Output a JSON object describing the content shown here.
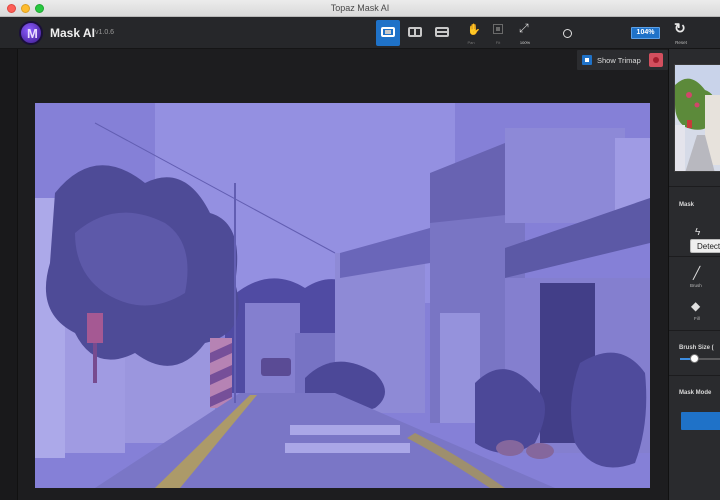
{
  "window": {
    "title": "Topaz Mask AI"
  },
  "app": {
    "name": "Mask AI",
    "version": "v1.0.6"
  },
  "toolbar": {
    "view_buttons": [
      {
        "name": "single-view-button",
        "active": true
      },
      {
        "name": "side-by-side-view-button",
        "active": false
      },
      {
        "name": "split-view-button",
        "active": false
      }
    ],
    "pan_label": "Pan",
    "fit_label": "Fit",
    "zoom_100_label": "100%",
    "zoom_value": "104%",
    "reset_label": "Reset"
  },
  "canvas": {
    "show_trimap_label": "Show Trimap",
    "show_trimap_checked": true,
    "trimap_color": "#d34f5e",
    "overlay_color": "#5a55d8"
  },
  "panel": {
    "mask_title": "Mask",
    "detect_label": "Detect",
    "brush_label": "Brush",
    "fill_label": "Fill",
    "brush_size_title": "Brush Size (",
    "brush_size_fraction": 0.35,
    "mask_mode_title": "Mask Mode"
  },
  "colors": {
    "accent": "#1f72c8",
    "toolbar_bg": "#26272a",
    "canvas_bg": "#1d1d1f"
  }
}
